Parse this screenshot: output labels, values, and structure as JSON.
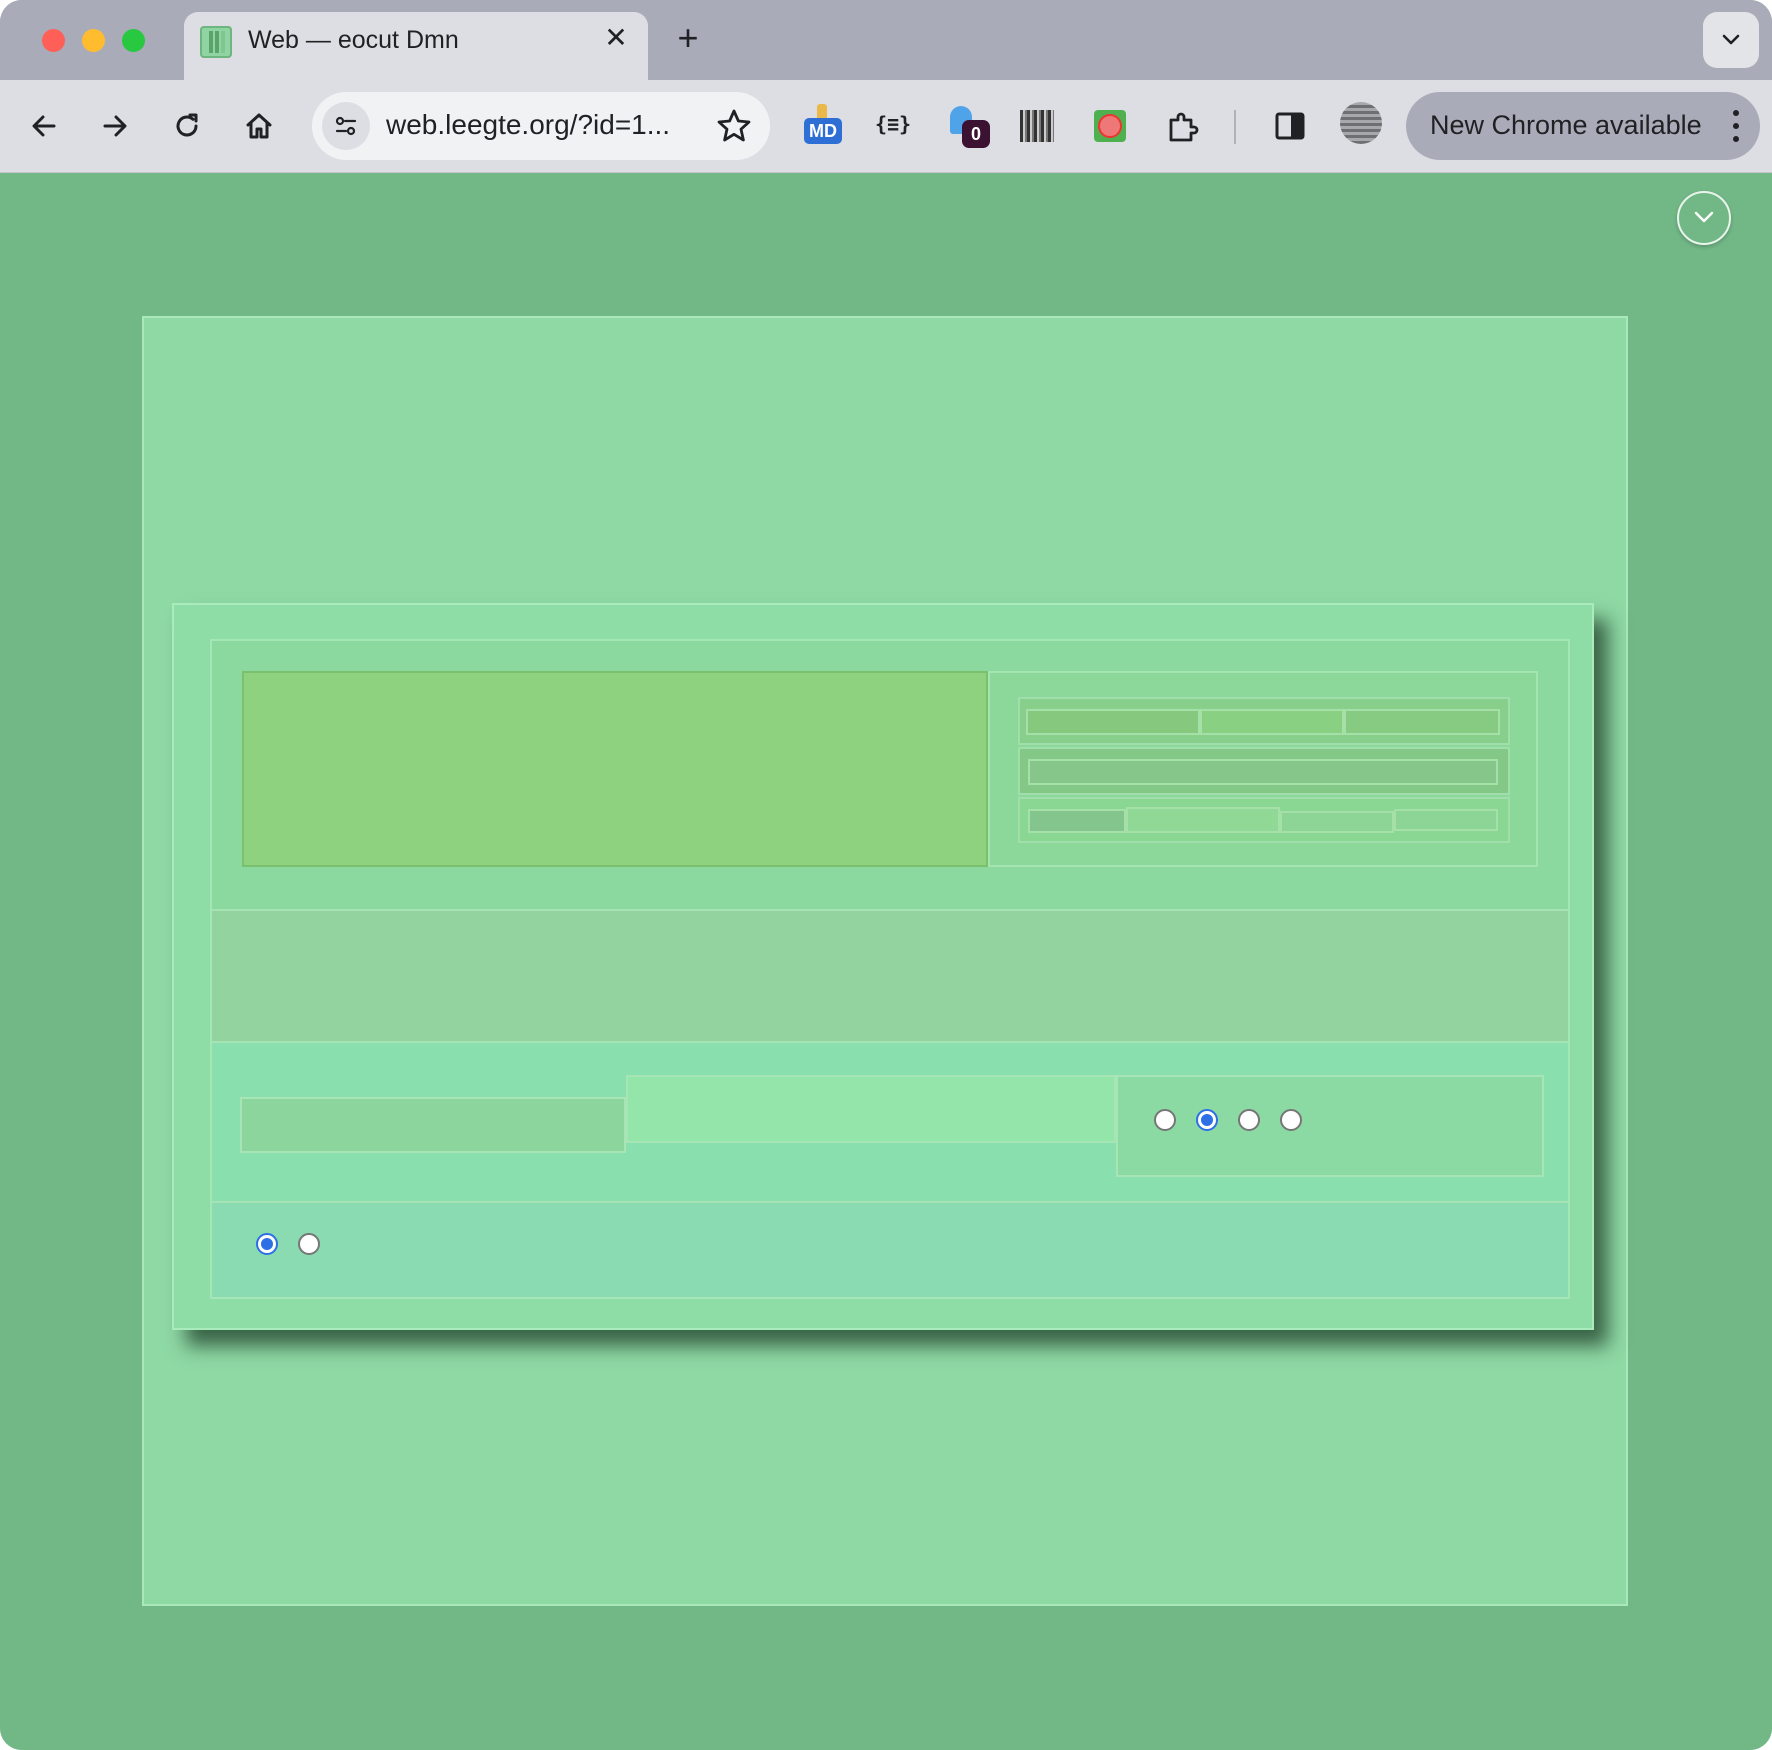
{
  "browser": {
    "tab": {
      "title": "Web — eocut Dmn",
      "close_icon": "close-icon",
      "favicon": "site-favicon"
    },
    "new_tab_icon": "plus-icon",
    "tab_search_icon": "chevron-down-icon",
    "toolbar": {
      "back_icon": "arrow-left-icon",
      "forward_icon": "arrow-right-icon",
      "reload_icon": "reload-icon",
      "home_icon": "home-icon",
      "site_info_icon": "tune-icon",
      "url": "web.leegte.org/?id=1...",
      "bookmark_icon": "star-icon"
    },
    "extensions": {
      "markdown_badge": "MD",
      "json_viewer_label": "{≡}",
      "ghostery_count": "0",
      "puzzle_icon": "puzzle-icon",
      "side_panel_icon": "side-panel-icon"
    },
    "update_button": {
      "label": "New Chrome available",
      "menu_icon": "kebab-menu-icon"
    }
  },
  "page": {
    "collapse_icon": "chevron-down-icon",
    "colors": {
      "background": "#72b886",
      "paper": "#8fd9a5",
      "card": "#8fdda6",
      "block": "#8ed17e",
      "radio_checked": "#2f6fe6"
    },
    "radio_group_1": {
      "options": 4,
      "selected_index": 1
    },
    "radio_group_2": {
      "options": 2,
      "selected_index": 0
    }
  }
}
